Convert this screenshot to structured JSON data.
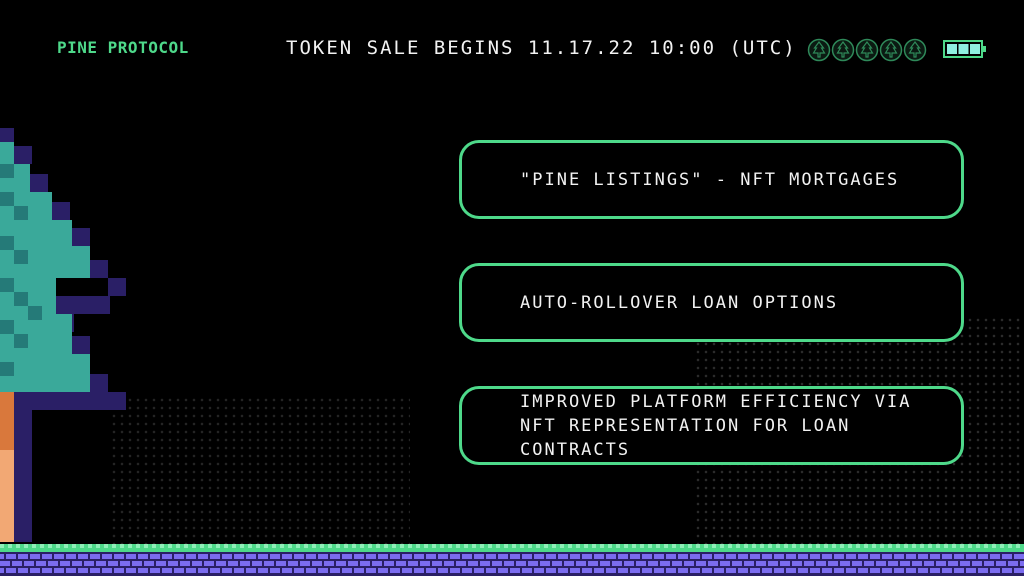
{
  "header": {
    "brand": "PINE PROTOCOL",
    "headline": "TOKEN SALE BEGINS 11.17.22 10:00 (UTC)",
    "pine_icon_count": 5,
    "battery_level": 1.0
  },
  "features": [
    {
      "text": "\"PINE LISTINGS\" - NFT MORTGAGES"
    },
    {
      "text": "AUTO-ROLLOVER LOAN OPTIONS"
    },
    {
      "text": "IMPROVED PLATFORM EFFICIENCY VIA NFT REPRESENTATION FOR LOAN CONTRACTS"
    }
  ],
  "colors": {
    "accent": "#4ed98a",
    "background": "#000000",
    "text": "#f2f2f2",
    "tree_teal": "#3aa99a",
    "tree_shadow": "#2a1f66",
    "trunk": "#e08a4a",
    "ground_top": "#4ed98a",
    "ground_brick": "#7b6cf0"
  },
  "icons": {
    "pine": "pine-tree-coin-icon",
    "battery": "battery-icon",
    "tree": "pixel-pine-tree"
  }
}
